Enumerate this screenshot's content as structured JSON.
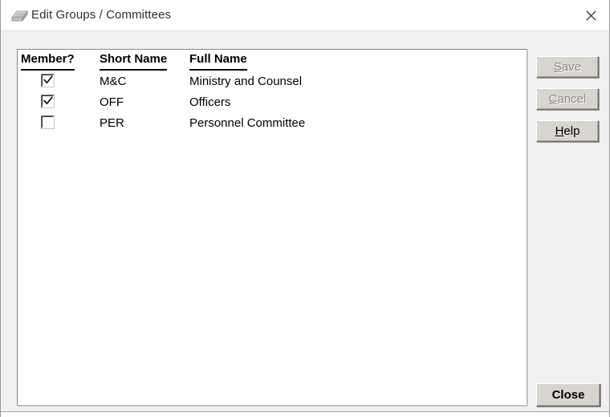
{
  "window": {
    "title": "Edit Groups / Committees",
    "icon": "card-file-icon",
    "close_icon": "close-icon",
    "background_color": "#f0f0f0",
    "titlebar_color": "#ffffff"
  },
  "list": {
    "columns": [
      {
        "key": "member",
        "label": "Member?"
      },
      {
        "key": "short_name",
        "label": "Short Name"
      },
      {
        "key": "full_name",
        "label": "Full Name"
      }
    ],
    "rows": [
      {
        "member": true,
        "short_name": "M&C",
        "full_name": "Ministry and Counsel"
      },
      {
        "member": true,
        "short_name": "OFF",
        "full_name": "Officers"
      },
      {
        "member": false,
        "short_name": "PER",
        "full_name": "Personnel Committee"
      }
    ]
  },
  "buttons": {
    "save": {
      "label": "Save",
      "accel": "S",
      "before": "",
      "after": "ave",
      "enabled": false
    },
    "cancel": {
      "label": "Cancel",
      "accel": "C",
      "before": "",
      "after": "ancel",
      "enabled": false
    },
    "help": {
      "label": "Help",
      "accel": "H",
      "before": "",
      "after": "elp",
      "enabled": true
    },
    "close": {
      "label": "Close",
      "accel": "",
      "before": "Close",
      "after": "",
      "enabled": true,
      "default": true
    }
  },
  "background_window": {
    "partial_text": "▔▔▔▔ ▔▔▔ ▔▔ ▔ ▔▔▔ ▔▔▔▔ ▔▔ ▔▔▔▔ ▔▔▔ ▔▔▔▔▔"
  }
}
